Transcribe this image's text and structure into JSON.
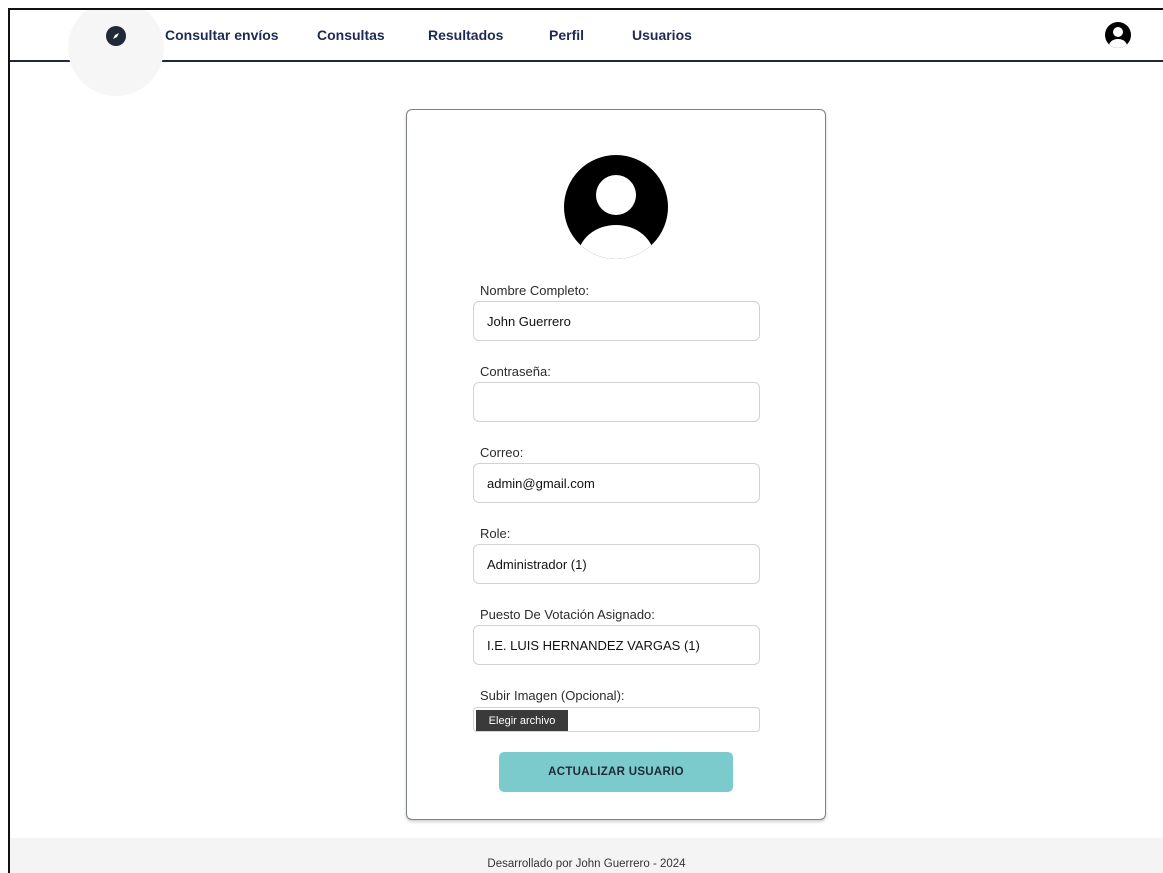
{
  "navbar": {
    "logo_icon": "compass-icon",
    "links": [
      {
        "label": "Consultar envíos"
      },
      {
        "label": "Consultas"
      },
      {
        "label": "Resultados"
      },
      {
        "label": "Perfil"
      },
      {
        "label": "Usuarios"
      }
    ],
    "user_icon": "user-icon"
  },
  "form": {
    "avatar_icon": "avatar-icon",
    "fields": {
      "nombre": {
        "label": "Nombre Completo:",
        "value": "John Guerrero"
      },
      "contrasena": {
        "label": "Contraseña:",
        "value": ""
      },
      "correo": {
        "label": "Correo:",
        "value": "admin@gmail.com"
      },
      "role": {
        "label": "Role:",
        "value": "Administrador (1)"
      },
      "puesto": {
        "label": "Puesto De Votación Asignado:",
        "value": "I.E. LUIS HERNANDEZ VARGAS (1)"
      },
      "imagen": {
        "label": "Subir Imagen (Opcional):",
        "button_label": "Elegir archivo"
      }
    },
    "submit_label": "ACTUALIZAR USUARIO"
  },
  "footer": {
    "text": "Desarrollado por John Guerrero - 2024"
  },
  "colors": {
    "nav_text": "#1e2a55",
    "submit_button": "#7ccbcc",
    "file_button": "#3a3a3a"
  }
}
